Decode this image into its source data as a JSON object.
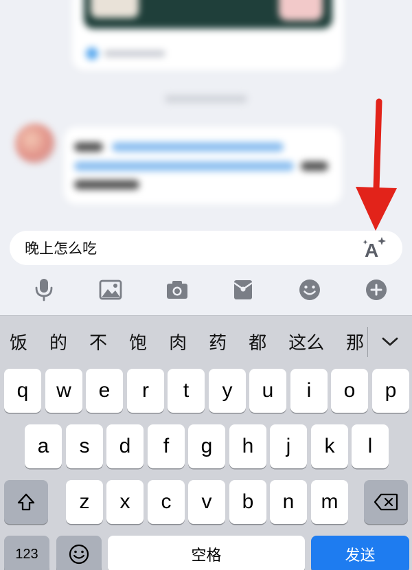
{
  "input": {
    "text": "晚上怎么吃",
    "ai_icon": "ai-sparkle-text-icon"
  },
  "toolbar": {
    "icons": [
      "microphone-icon",
      "image-icon",
      "camera-icon",
      "red-packet-icon",
      "emoji-icon",
      "plus-icon"
    ]
  },
  "candidates": {
    "items": [
      "饭",
      "的",
      "不",
      "饱",
      "肉",
      "药",
      "都",
      "这么",
      "那"
    ],
    "expand_icon": "chevron-down-icon"
  },
  "keyboard": {
    "row1": [
      "q",
      "w",
      "e",
      "r",
      "t",
      "y",
      "u",
      "i",
      "o",
      "p"
    ],
    "row2": [
      "a",
      "s",
      "d",
      "f",
      "g",
      "h",
      "j",
      "k",
      "l"
    ],
    "row3": [
      "z",
      "x",
      "c",
      "v",
      "b",
      "n",
      "m"
    ],
    "numbers_label": "123",
    "space_label": "空格",
    "send_label": "发送",
    "shift_icon": "shift-icon",
    "backspace_icon": "backspace-icon",
    "emoji_key_icon": "emoji-icon"
  },
  "colors": {
    "send_key": "#1e7cf0",
    "annotation_arrow": "#e2231a",
    "keyboard_bg": "#d1d3d9",
    "chat_bg": "#eef0f5"
  }
}
